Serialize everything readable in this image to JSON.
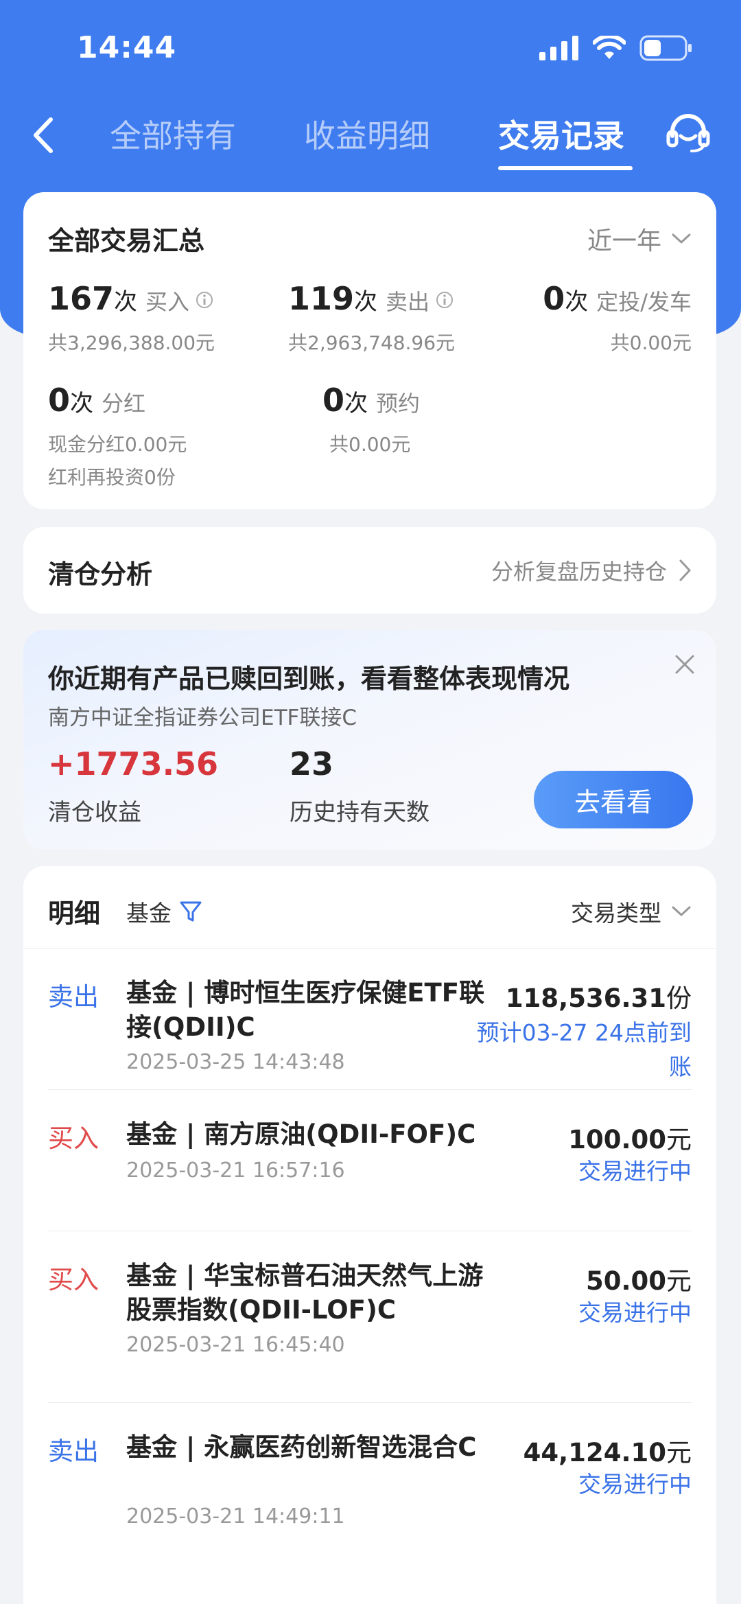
{
  "status_bar": {
    "time": "14:44"
  },
  "nav": {
    "tabs": [
      {
        "label": "全部持有"
      },
      {
        "label": "收益明细"
      },
      {
        "label": "交易记录"
      }
    ]
  },
  "summary": {
    "title": "全部交易汇总",
    "period": "近一年",
    "buy": {
      "count": "167",
      "unit": "次",
      "label": "买入",
      "sub_prefix": "共",
      "sub_value": "3,296,388.00",
      "sub_suffix": "元"
    },
    "sell": {
      "count": "119",
      "unit": "次",
      "label": "卖出",
      "sub_prefix": "共",
      "sub_value": "2,963,748.96",
      "sub_suffix": "元"
    },
    "plan": {
      "count": "0",
      "unit": "次",
      "label": "定投/发车",
      "sub_prefix": "共",
      "sub_value": "0.00",
      "sub_suffix": "元"
    },
    "dividend": {
      "count": "0",
      "unit": "次",
      "label": "分红",
      "cash_prefix": "现金分红",
      "cash_value": "0.00",
      "cash_suffix": "元",
      "reinvest_prefix": "红利再投资",
      "reinvest_value": "0",
      "reinvest_suffix": "份"
    },
    "reserve": {
      "count": "0",
      "unit": "次",
      "label": "预约",
      "sub_prefix": "共",
      "sub_value": "0.00",
      "sub_suffix": "元"
    }
  },
  "clearance": {
    "title": "清仓分析",
    "link": "分析复盘历史持仓"
  },
  "promo": {
    "title": "你近期有产品已赎回到账，看看整体表现情况",
    "fund": "南方中证全指证券公司ETF联接C",
    "profit": "+1773.56",
    "profit_label": "清仓收益",
    "days": "23",
    "days_label": "历史持有天数",
    "button": "去看看"
  },
  "detail": {
    "title": "明细",
    "filter": "基金",
    "type_select": "交易类型",
    "transactions": [
      {
        "type": "卖出",
        "name": "基金 | 博时恒生医疗保健ETF联接(QDII)C",
        "date": "2025-03-25 14:43:48",
        "amount": "118,536.31",
        "unit": "份",
        "status": "预计03-27 24点前到账"
      },
      {
        "type": "买入",
        "name": "基金 | 南方原油(QDII-FOF)C",
        "date": "2025-03-21 16:57:16",
        "amount": "100.00",
        "unit": "元",
        "status": "交易进行中"
      },
      {
        "type": "买入",
        "name": "基金 | 华宝标普石油天然气上游股票指数(QDII-LOF)C",
        "date": "2025-03-21 16:45:40",
        "amount": "50.00",
        "unit": "元",
        "status": "交易进行中"
      },
      {
        "type": "卖出",
        "name": "基金 | 永赢医药创新智选混合C",
        "date": "2025-03-21 14:49:11",
        "amount": "44,124.10",
        "unit": "元",
        "status": "交易进行中"
      }
    ]
  },
  "colors": {
    "header_blue": "#3f7cf0",
    "sell_blue": "#3a72e8",
    "buy_red": "#e04a4a",
    "profit_red": "#d7363c"
  }
}
